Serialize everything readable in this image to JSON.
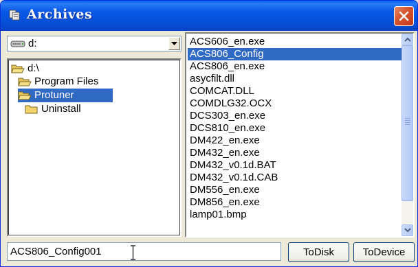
{
  "window": {
    "title": "Archives",
    "close_icon": "close-icon",
    "title_icon": "archive-icon"
  },
  "drive": {
    "selected": "d:",
    "icon": "drive-icon"
  },
  "folders": [
    {
      "label": "d:\\",
      "icon": "open-folder-icon",
      "selected": false
    },
    {
      "label": "Program Files",
      "icon": "open-folder-icon",
      "selected": false
    },
    {
      "label": "Protuner",
      "icon": "open-folder-icon",
      "selected": true
    },
    {
      "label": "Uninstall",
      "icon": "folder-icon",
      "selected": false
    }
  ],
  "files": [
    {
      "name": "ACS606_en.exe",
      "selected": false
    },
    {
      "name": "ACS806_Config",
      "selected": true
    },
    {
      "name": "ACS806_en.exe",
      "selected": false
    },
    {
      "name": "asycfilt.dll",
      "selected": false
    },
    {
      "name": "COMCAT.DLL",
      "selected": false
    },
    {
      "name": "COMDLG32.OCX",
      "selected": false
    },
    {
      "name": "DCS303_en.exe",
      "selected": false
    },
    {
      "name": "DCS810_en.exe",
      "selected": false
    },
    {
      "name": "DM422_en.exe",
      "selected": false
    },
    {
      "name": "DM432_en.exe",
      "selected": false
    },
    {
      "name": "DM432_v0.1d.BAT",
      "selected": false
    },
    {
      "name": "DM432_v0.1d.CAB",
      "selected": false
    },
    {
      "name": "DM556_en.exe",
      "selected": false
    },
    {
      "name": "DM856_en.exe",
      "selected": false
    },
    {
      "name": "lamp01.bmp",
      "selected": false
    }
  ],
  "filename_input": {
    "value": "ACS806_Config001"
  },
  "buttons": {
    "to_disk": "ToDisk",
    "to_device": "ToDevice"
  },
  "colors": {
    "title_bar": "#0650d8",
    "selection": "#316ac5",
    "close_button": "#d4532b"
  }
}
